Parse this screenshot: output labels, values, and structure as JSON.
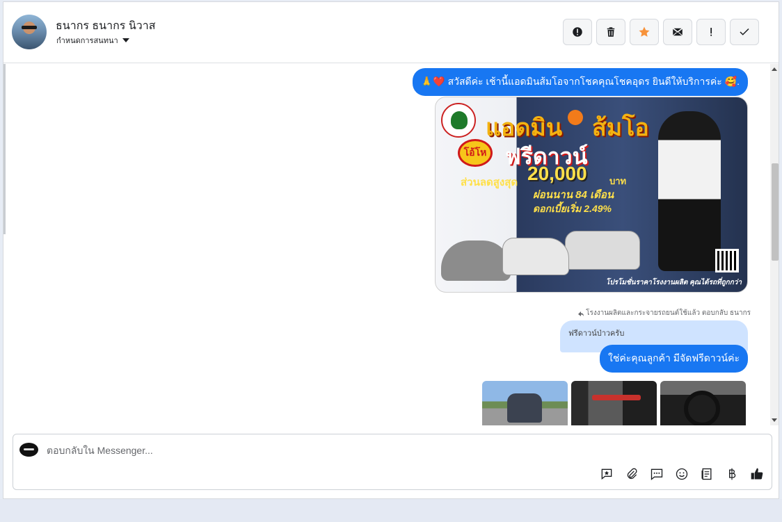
{
  "header": {
    "name": "ธนากร ธนากร นิวาส",
    "label_selector": "กำหนดการสนทนา",
    "actions": [
      "spam-icon",
      "trash-icon",
      "star-icon",
      "mail-icon",
      "important-icon",
      "check-icon"
    ]
  },
  "messages": {
    "greeting": "🙏❤️ สวัสดีค่ะ เช้านี้แอดมินส้มโอจากโชคคุณโชคอุดร ยินดีให้บริการค่ะ 🥰.",
    "promo": {
      "title_left": "แอดมิน",
      "title_right": "ส้มโอ",
      "badge": "โอ้โห",
      "headline": "ฟรีดาวน์",
      "discount_label": "ส่วนลดสูงสุด",
      "discount_amount": "20,000",
      "currency": "บาท",
      "installment": "ผ่อนนาน 84 เดือน",
      "interest": "ดอกเบี้ยเริ่ม 2.49%",
      "footer": "โปรโมชั่นราคาโรงงานผลิต คุณได้รถที่ถูกกว่า"
    },
    "forward_note": "โรงงานผลิตและกระจายรถยนต์ใช้แล้ว ตอบกลับ ธนากร",
    "reply_quote": "ฟรีดาวน์ป่าวครับ",
    "reply": "ใช่ค่ะคุณลูกค้า มีจัดฟรีดาวน์ค่ะ"
  },
  "composer": {
    "placeholder": "ตอบกลับใน Messenger...",
    "tools": [
      "saved-reply-icon",
      "attach-icon",
      "chat-icon",
      "emoji-icon",
      "notes-icon",
      "baht-icon",
      "like-icon"
    ]
  },
  "colors": {
    "accent": "#1877f2",
    "quote_bg": "#cfe3ff",
    "star": "#f7923a"
  }
}
